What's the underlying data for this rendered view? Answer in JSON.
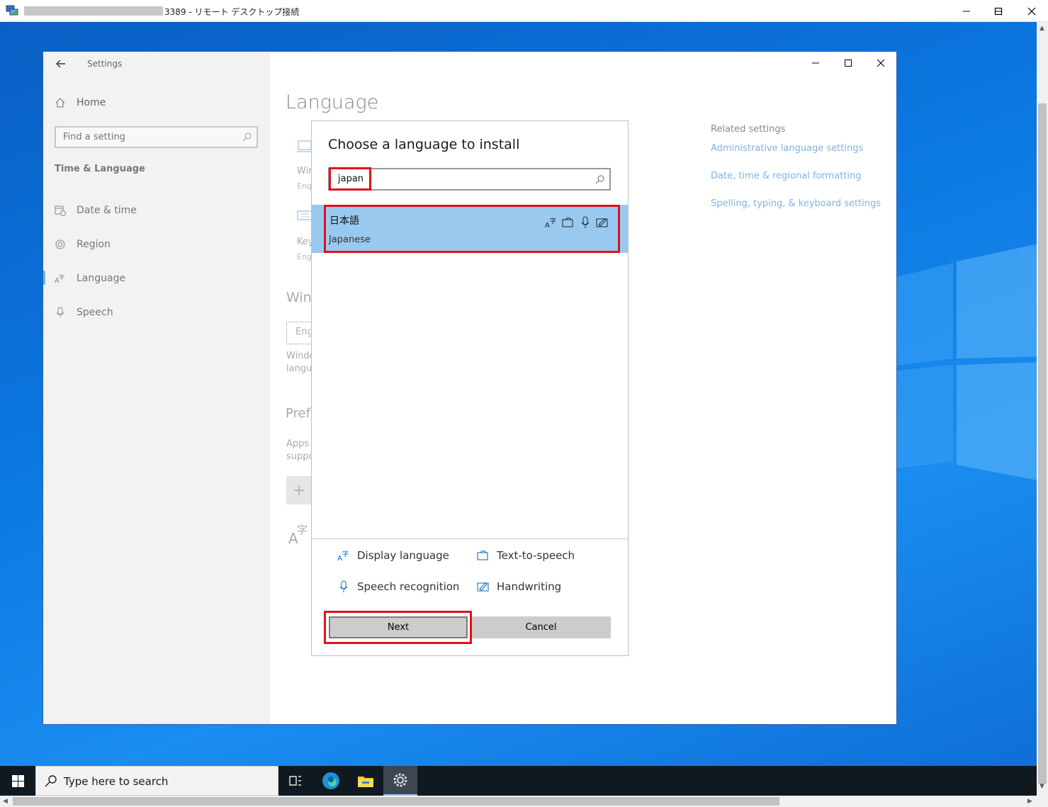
{
  "rdp_window": {
    "title": "3389 - リモート デスクトップ接続"
  },
  "settings": {
    "app_title": "Settings",
    "home_label": "Home",
    "search_placeholder": "Find a setting",
    "section_title": "Time & Language",
    "nav_items": [
      {
        "label": "Date & time",
        "icon": "calendar-clock-icon"
      },
      {
        "label": "Region",
        "icon": "globe-icon"
      },
      {
        "label": "Language",
        "icon": "language-icon",
        "selected": true
      },
      {
        "label": "Speech",
        "icon": "microphone-icon"
      }
    ],
    "page_title": "Language",
    "peek_texts": [
      "Win",
      "Eng",
      "Key",
      "Eng",
      "Wind",
      "Eng",
      "Windo",
      "langu",
      "Prefe",
      "Apps",
      "suppo"
    ],
    "related": {
      "title": "Related settings",
      "links": [
        "Administrative language settings",
        "Date, time & regional formatting",
        "Spelling, typing, & keyboard settings"
      ]
    }
  },
  "dialog": {
    "title": "Choose a language to install",
    "search_value": "japan",
    "result": {
      "native": "日本語",
      "english": "Japanese",
      "features": [
        "display-language-icon",
        "text-to-speech-icon",
        "speech-recognition-icon",
        "handwriting-icon"
      ]
    },
    "legend": [
      {
        "label": "Display language",
        "icon": "display-language-icon"
      },
      {
        "label": "Text-to-speech",
        "icon": "text-to-speech-icon"
      },
      {
        "label": "Speech recognition",
        "icon": "speech-recognition-icon"
      },
      {
        "label": "Handwriting",
        "icon": "handwriting-icon"
      }
    ],
    "next_label": "Next",
    "cancel_label": "Cancel"
  },
  "taskbar": {
    "search_placeholder": "Type here to search",
    "apps": [
      "task-view-icon",
      "edge-icon",
      "file-explorer-icon",
      "settings-gear-icon"
    ]
  },
  "colors": {
    "accent": "#0078d7",
    "highlight": "#e0101c",
    "selected_row": "#99c9ef",
    "link": "#7fb3e6"
  }
}
